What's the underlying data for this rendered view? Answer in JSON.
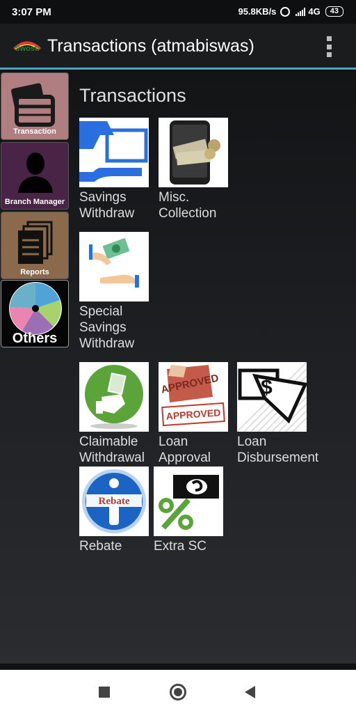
{
  "status": {
    "time": "3:07 PM",
    "speed": "95.8KB/s",
    "network": "4G",
    "battery": "43"
  },
  "app_bar": {
    "title": "Transactions (atmabiswas)",
    "logo_text": "Swosti"
  },
  "sidebar": {
    "items": [
      {
        "label": "Transaction"
      },
      {
        "label": "Branch Manager"
      },
      {
        "label": "Reports"
      },
      {
        "label": "Others"
      }
    ]
  },
  "main": {
    "section_title": "Transactions",
    "tiles": [
      {
        "label": "Savings Withdraw"
      },
      {
        "label": "Misc. Collection"
      },
      {
        "label": "Special Savings Withdraw"
      },
      {
        "label": "Claimable Withdrawal"
      },
      {
        "label": "Loan Approval"
      },
      {
        "label": "Loan Disbursement"
      },
      {
        "label": "Rebate"
      },
      {
        "label": "Extra SC"
      }
    ],
    "icon_texts": {
      "approved": "APPROVED",
      "rebate": "Rebate"
    }
  },
  "colors": {
    "accent": "#4aa3c8",
    "transaction_btn": "#b07d80",
    "branch_manager_btn": "#4a2446",
    "reports_btn": "#8a6a4a"
  }
}
